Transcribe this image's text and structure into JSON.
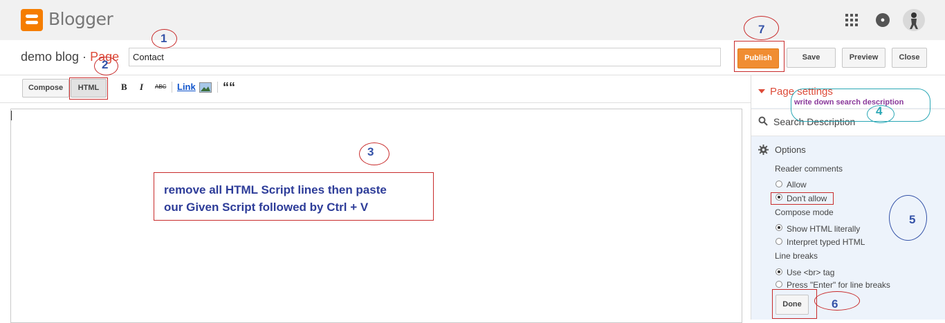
{
  "header": {
    "app_name": "Blogger",
    "icons": [
      "apps-icon",
      "notifications-icon",
      "avatar"
    ]
  },
  "editor_header": {
    "blog_name": "demo blog · ",
    "page_word": "Page",
    "title_value": "Contact",
    "buttons": {
      "publish": "Publish",
      "save": "Save",
      "preview": "Preview",
      "close": "Close"
    }
  },
  "toolbar": {
    "compose": "Compose",
    "html": "HTML",
    "bold": "B",
    "italic": "I",
    "strike": "ABC",
    "link": "Link",
    "quote": "““"
  },
  "sidebar": {
    "page_settings": "Page settings",
    "search_description": "Search Description",
    "options": "Options",
    "reader_comments": {
      "label": "Reader comments",
      "allow": "Allow",
      "dont_allow": "Don't allow",
      "selected": "dont_allow"
    },
    "compose_mode": {
      "label": "Compose mode",
      "show_html": "Show HTML literally",
      "interpret": "Interpret typed HTML",
      "selected": "show_html"
    },
    "line_breaks": {
      "label": "Line breaks",
      "use_br": "Use <br> tag",
      "press_enter": "Press \"Enter\" for line breaks",
      "selected": "use_br"
    },
    "done": "Done"
  },
  "annotations": {
    "n1": "1",
    "n2": "2",
    "n3": "3",
    "n4": "4",
    "n5": "5",
    "n6": "6",
    "n7": "7",
    "note_line1": "remove all HTML Script lines then paste",
    "note_line2": "our Given Script followed by Ctrl + V",
    "search_tip": "write down search description"
  },
  "colors": {
    "brand": "#f57d00",
    "publish": "#f08d32",
    "accent_red": "#dd4b39",
    "annotation_red": "#c82b2b",
    "annotation_blue": "#3553a8"
  }
}
